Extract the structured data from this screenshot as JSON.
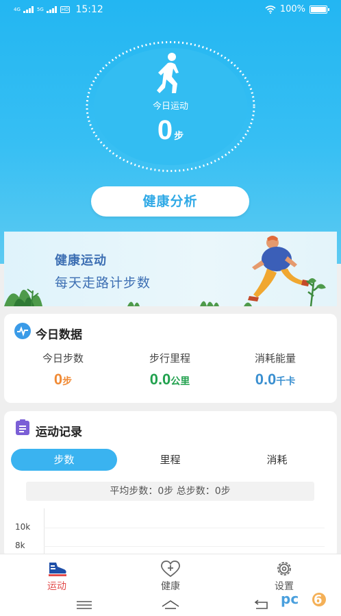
{
  "status_bar": {
    "signal1": "4G",
    "signal2": "5G",
    "hd": "HD",
    "time": "15:12",
    "battery": "100%"
  },
  "hero": {
    "today_label": "今日运动",
    "steps_value": "0",
    "steps_unit": "步",
    "analysis_button": "健康分析"
  },
  "banner": {
    "line1": "健康运动",
    "line2": "每天走路计步数"
  },
  "today_data": {
    "title": "今日数据",
    "stats": [
      {
        "label": "今日步数",
        "value": "0",
        "unit": "步",
        "color": "#f08a35"
      },
      {
        "label": "步行里程",
        "value": "0.0",
        "unit": "公里",
        "color": "#21a14e"
      },
      {
        "label": "消耗能量",
        "value": "0.0",
        "unit": "千卡",
        "color": "#3a8fd0"
      }
    ]
  },
  "records": {
    "title": "运动记录",
    "tabs": [
      {
        "label": "步数",
        "active": true
      },
      {
        "label": "里程",
        "active": false
      },
      {
        "label": "消耗",
        "active": false
      }
    ],
    "summary": "平均步数：0步 总步数：0步",
    "y_ticks": [
      "10k",
      "8k"
    ]
  },
  "bottom_nav": [
    {
      "label": "运动",
      "icon": "shoe-icon",
      "active": true
    },
    {
      "label": "健康",
      "icon": "heart-plus-icon",
      "active": false
    },
    {
      "label": "设置",
      "icon": "gear-icon",
      "active": false
    }
  ],
  "system_nav": {
    "menu": "menu-icon",
    "home": "home-icon",
    "back": "back-icon"
  },
  "watermark": "pc6",
  "colors": {
    "accent": "#3ab3f0",
    "hero": "#23b6f2",
    "nav_active": "#e24a4a"
  }
}
